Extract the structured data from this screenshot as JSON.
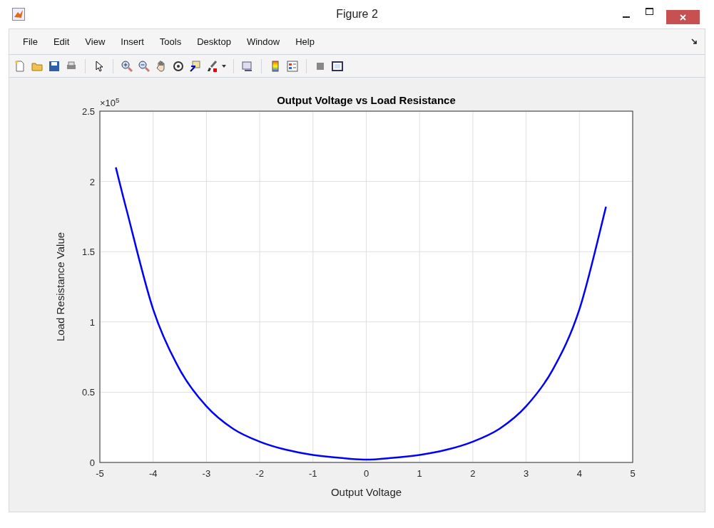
{
  "window": {
    "title": "Figure 2"
  },
  "menu": [
    "File",
    "Edit",
    "View",
    "Insert",
    "Tools",
    "Desktop",
    "Window",
    "Help"
  ],
  "figure": {
    "chart_data": {
      "type": "line",
      "title": "Output Voltage vs Load Resistance",
      "xlabel": "Output Voltage",
      "ylabel": "Load Resistance Value",
      "x": [
        -4.7,
        -4.5,
        -4,
        -3.5,
        -3,
        -2.5,
        -2,
        -1.5,
        -1,
        -0.5,
        0,
        0.5,
        1,
        1.5,
        2,
        2.5,
        3,
        3.5,
        4,
        4.5
      ],
      "series": [
        {
          "color": "#0000ff",
          "values": [
            2.1,
            1.8,
            1.09,
            0.66,
            0.4,
            0.24,
            0.148,
            0.09,
            0.054,
            0.033,
            0.02,
            0.033,
            0.054,
            0.09,
            0.148,
            0.24,
            0.4,
            0.66,
            1.09,
            1.82
          ]
        }
      ],
      "grid": true,
      "xlim": [
        -5,
        5
      ],
      "ylim": [
        0,
        2.5
      ],
      "xticks": [
        -5,
        -4,
        -3,
        -2,
        -1,
        0,
        1,
        2,
        3,
        4,
        5
      ],
      "yticks": [
        0,
        0.5,
        1,
        1.5,
        2,
        2.5
      ],
      "annotations": [
        {
          "text": "×10$^{5}$"
        }
      ]
    }
  }
}
